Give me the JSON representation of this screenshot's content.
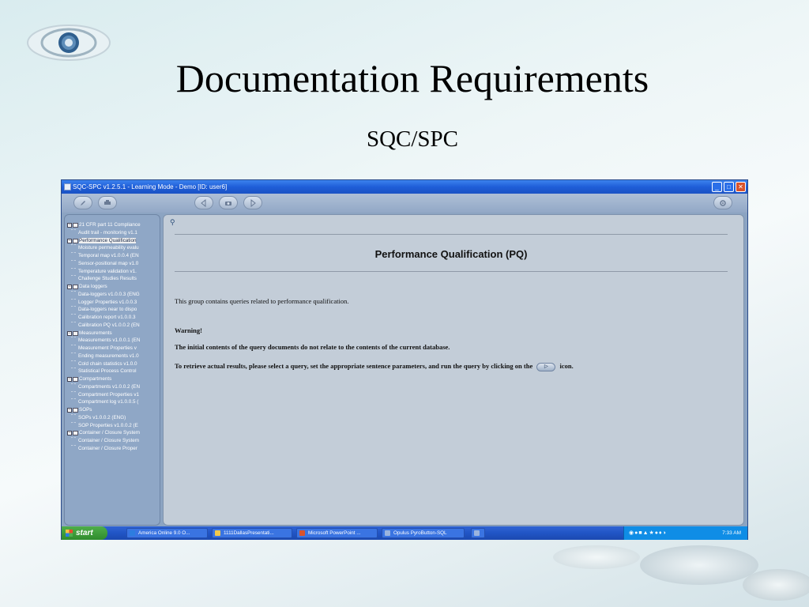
{
  "slide": {
    "title": "Documentation Requirements",
    "subtitle": "SQC/SPC"
  },
  "window": {
    "title": "SQC-SPC v1.2.5.1 - Learning Mode - Demo [ID: user6]",
    "min_glyph": "_",
    "max_glyph": "□",
    "close_glyph": "✕"
  },
  "sidebar": {
    "items": [
      {
        "kind": "group",
        "label": "21 CFR part 11 Compliance"
      },
      {
        "kind": "child",
        "label": "Audit trail - monitoring v1.1"
      },
      {
        "kind": "group",
        "label": "Performance Qualification",
        "selected": true
      },
      {
        "kind": "child",
        "label": "Moisture permeability evalu"
      },
      {
        "kind": "child",
        "label": "Temporal map v1.0.0.4 (EN"
      },
      {
        "kind": "child",
        "label": "Sensor-positional map v1.0"
      },
      {
        "kind": "child",
        "label": "Temperature validation v1."
      },
      {
        "kind": "child",
        "label": "Challenge Studies Results"
      },
      {
        "kind": "group",
        "label": "Data loggers"
      },
      {
        "kind": "child",
        "label": "Data-loggers v1.0.0.3 (ENG"
      },
      {
        "kind": "child",
        "label": "Logger Properties v1.0.0.3"
      },
      {
        "kind": "child",
        "label": "Data-loggers near to dispo"
      },
      {
        "kind": "child",
        "label": "Calibration report v1.0.0.3"
      },
      {
        "kind": "child",
        "label": "Calibration PQ v1.0.0.2 (EN"
      },
      {
        "kind": "group",
        "label": "Measurements"
      },
      {
        "kind": "child",
        "label": "Measurements v1.0.0.1 (EN"
      },
      {
        "kind": "child",
        "label": "Measurement Properties v"
      },
      {
        "kind": "child",
        "label": "Ending measurements v1.0"
      },
      {
        "kind": "child",
        "label": "Cold chain statistics v1.0.0"
      },
      {
        "kind": "child",
        "label": "Statistical Process Control"
      },
      {
        "kind": "group",
        "label": "Compartments"
      },
      {
        "kind": "child",
        "label": "Compartments v1.0.0.2 (EN"
      },
      {
        "kind": "child",
        "label": "Compartment Properties v1"
      },
      {
        "kind": "child",
        "label": "Compartment log v1.0.0.5 ("
      },
      {
        "kind": "group",
        "label": "SOPs"
      },
      {
        "kind": "child",
        "label": "SOPs v1.0.0.2 (ENG)"
      },
      {
        "kind": "child",
        "label": "SOP Properties v1.0.0.2 (E"
      },
      {
        "kind": "group",
        "label": "Container / Closure System"
      },
      {
        "kind": "child",
        "label": "Container / Closure System"
      },
      {
        "kind": "child",
        "label": "Container / Closure Proper"
      }
    ]
  },
  "content": {
    "heading": "Performance Qualification (PQ)",
    "description": "This group contains queries related to performance qualification.",
    "warning_label": "Warning!",
    "warning_text": "The initial contents of the query documents do not relate to the contents of the current database.",
    "instruction_before": "To retrieve actual results, please select a query, set the appropriate sentence parameters, and run the query by clicking on the",
    "instruction_after": "icon.",
    "run_icon_glyph": "▷"
  },
  "taskbar": {
    "start_label": "start",
    "tasks": [
      {
        "label": "America Online 9.0 O...",
        "icon_color": "#2d7de0"
      },
      {
        "label": "1111DallasPresentati...",
        "icon_color": "#f2c94c"
      },
      {
        "label": "Microsoft PowerPoint ...",
        "icon_color": "#d9532c"
      },
      {
        "label": "Opulus PyroButton-SQL",
        "icon_color": "#9ab4de"
      }
    ],
    "clock": "7:33 AM"
  },
  "colors": {
    "title_bar": "#1f5ed8",
    "taskbar": "#2155c5",
    "start_button": "#3a9a37",
    "content_bg": "#c3cdd8",
    "sidebar_bg": "#8fa7c6"
  }
}
